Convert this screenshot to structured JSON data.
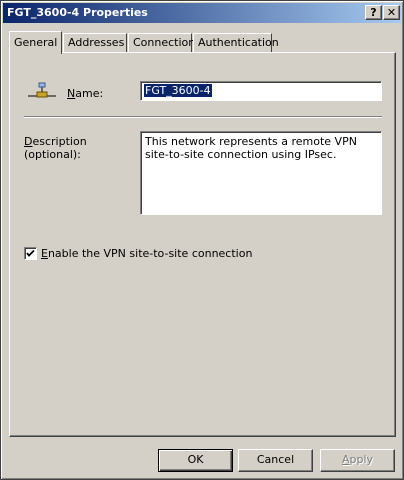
{
  "window": {
    "title": "FGT_3600-4 Properties",
    "help_label": "?",
    "close_label": "✕"
  },
  "tabs": [
    {
      "label": "General"
    },
    {
      "label": "Addresses"
    },
    {
      "label": "Connection"
    },
    {
      "label": "Authentication"
    }
  ],
  "general": {
    "name_label_u": "N",
    "name_label_rest": "ame:",
    "name_value": "FGT_3600-4",
    "description_label_u": "D",
    "description_label_rest1": "escription",
    "description_label_rest2": "(optional):",
    "description_value": "This network represents a remote VPN site-to-site connection using IPsec.",
    "enable_label_u": "E",
    "enable_label_rest": "nable the VPN site-to-site connection",
    "enable_checked": true
  },
  "buttons": {
    "ok": "OK",
    "cancel": "Cancel",
    "apply_u": "A",
    "apply_rest": "pply"
  },
  "colors": {
    "title_start": "#0a246a",
    "title_end": "#a6caf0",
    "face": "#d4d0c8",
    "selection": "#0a246a"
  },
  "icons": {
    "network": "network-icon",
    "check": "check-icon"
  }
}
